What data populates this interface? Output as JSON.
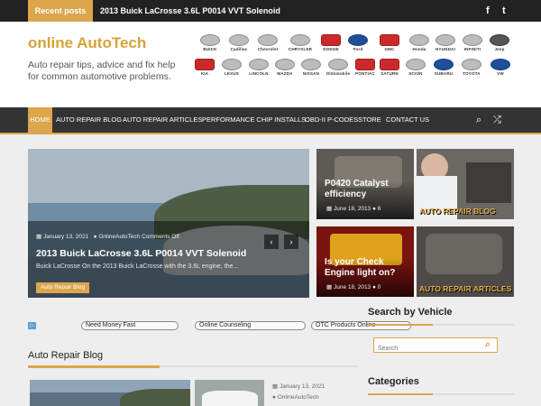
{
  "topbar": {
    "recent_label": "Recent posts",
    "recent_title": "2013 Buick LaCrosse 3.6L P0014 VVT Solenoid",
    "social": {
      "facebook": "f",
      "twitter": "t"
    }
  },
  "header": {
    "site_title": "online AutoTech",
    "tagline": "Auto repair tips, advice and fix help for common automotive problems.",
    "brands_row1": [
      "BUICK",
      "Cadillac",
      "Chevrolet",
      "CHRYSLER",
      "DODGE",
      "Ford",
      "GMC",
      "Honda",
      "HYUNDAI",
      "INFINITI",
      "Jeep"
    ],
    "brands_row2": [
      "KIA",
      "LEXUS",
      "LINCOLN",
      "MAZDA",
      "NISSAN",
      "Oldsmobile",
      "PONTIAC",
      "SATURN",
      "SCION",
      "SUBARU",
      "TOYOTA",
      "VW"
    ]
  },
  "nav": {
    "items": [
      "HOME",
      "AUTO REPAIR BLOG",
      "AUTO REPAIR ARTICLES",
      "PERFORMANCE CHIP INSTALLS",
      "OBD-II P-CODES",
      "STORE",
      "CONTACT US"
    ],
    "search_icon": "⌕",
    "random_icon": "⤮"
  },
  "hero": {
    "date": "January 13, 2021",
    "author": "OnlineAutoTech",
    "comments": "Comments Off",
    "title": "2013 Buick LaCrosse 3.6L P0014 VVT Solenoid",
    "excerpt": "Buick LaCrosse On the 2013 Buick LaCrosse with the 3.6L engine, the...",
    "category": "Auto Repair Blog",
    "prev": "‹",
    "next": "›"
  },
  "tiles": [
    {
      "title": "P0420 Catalyst efficiency",
      "date": "June 18, 2013",
      "comments": "6"
    },
    {
      "category": "AUTO REPAIR BLOG"
    },
    {
      "title": "Is your Check Engine light on?",
      "date": "June 18, 2013",
      "comments": "0"
    },
    {
      "category": "AUTO REPAIR ARTICLES"
    }
  ],
  "ads": {
    "icon": "▷",
    "links": [
      "Need Money Fast",
      "Online Counseling",
      "OTC Products Online"
    ]
  },
  "sidebar": {
    "search_heading": "Search by Vehicle",
    "search_placeholder": "Search",
    "categories_heading": "Categories"
  },
  "section": {
    "heading": "Auto Repair Blog",
    "post_date": "January 13, 2021",
    "post_author": "OnlineAutoTech"
  },
  "colors": {
    "accent": "#dca64d",
    "topbar": "#222222",
    "nav": "#333333"
  }
}
